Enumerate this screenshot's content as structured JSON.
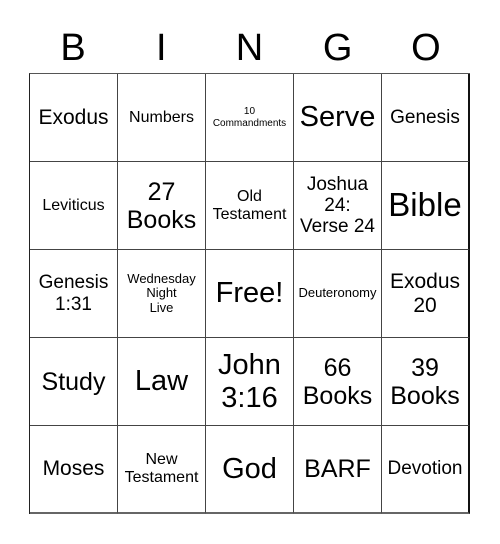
{
  "header": {
    "letters": [
      "B",
      "I",
      "N",
      "G",
      "O"
    ]
  },
  "cells": [
    {
      "text": "Exodus"
    },
    {
      "text": "Numbers"
    },
    {
      "text": "10\nCommandments"
    },
    {
      "text": "Serve"
    },
    {
      "text": "Genesis"
    },
    {
      "text": "Leviticus"
    },
    {
      "text": "27\nBooks"
    },
    {
      "text": "Old\nTestament"
    },
    {
      "text": "Joshua\n24:\nVerse 24"
    },
    {
      "text": "Bible"
    },
    {
      "text": "Genesis\n1:31"
    },
    {
      "text": "Wednesday\nNight\nLive"
    },
    {
      "text": "Free!"
    },
    {
      "text": "Deuteronomy"
    },
    {
      "text": "Exodus\n20"
    },
    {
      "text": "Study"
    },
    {
      "text": "Law"
    },
    {
      "text": "John\n3:16"
    },
    {
      "text": "66\nBooks"
    },
    {
      "text": "39\nBooks"
    },
    {
      "text": "Moses"
    },
    {
      "text": "New\nTestament"
    },
    {
      "text": "God"
    },
    {
      "text": "BARF"
    },
    {
      "text": "Devotion"
    }
  ]
}
